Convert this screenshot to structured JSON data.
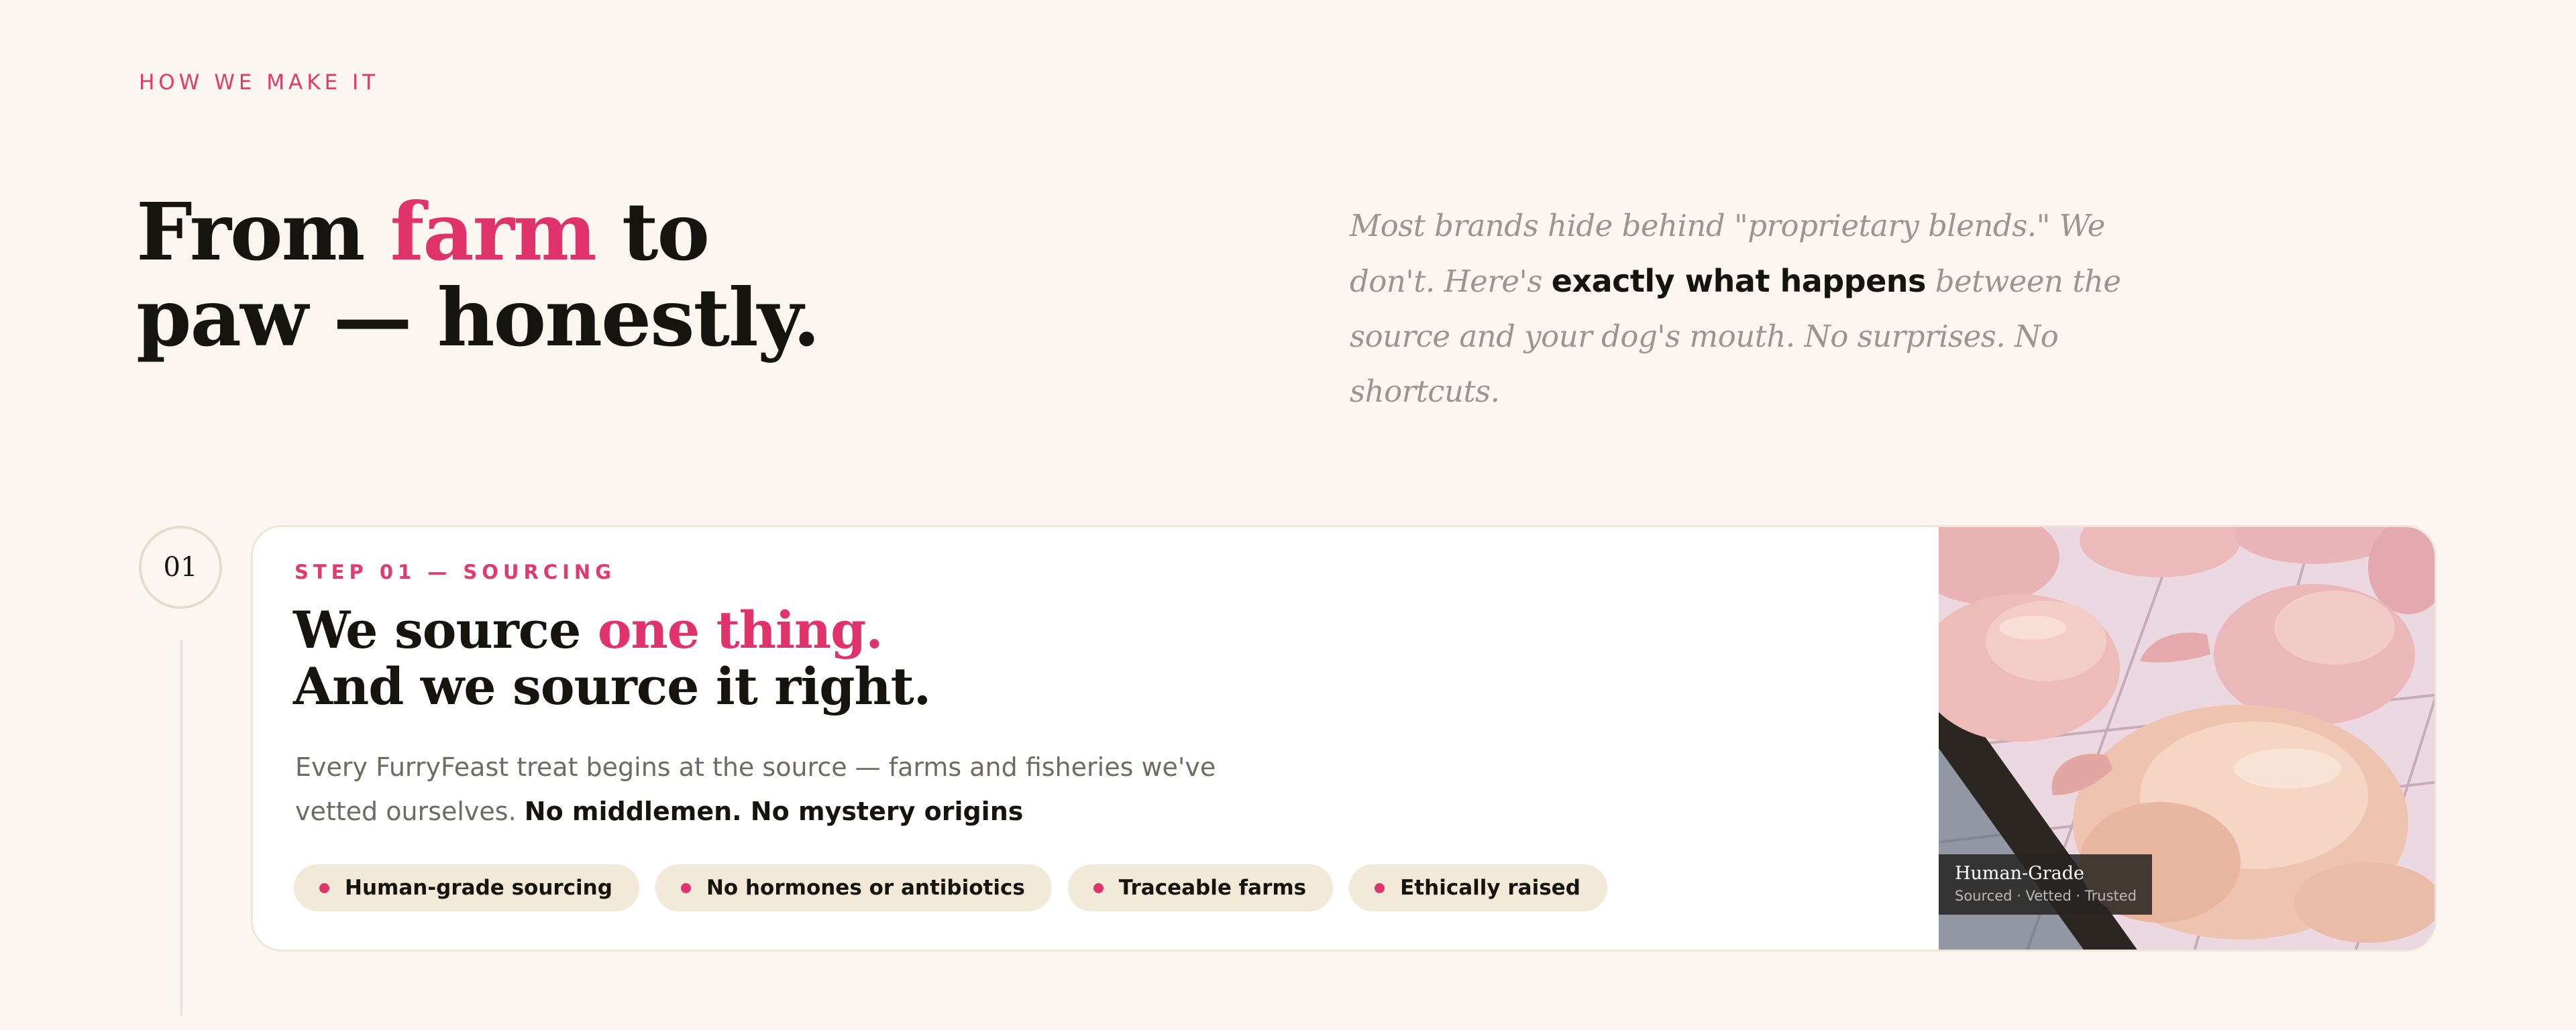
{
  "section": {
    "eyebrow": "HOW WE MAKE IT",
    "title": {
      "line1_before": "From ",
      "line1_accent": "farm",
      "line1_after": " to",
      "line2": "paw — honestly."
    },
    "intro": {
      "part1": "Most brands hide behind \"proprietary blends.\" We don't. Here's ",
      "strong": "exactly what happens",
      "part2": " between the source and your dog's mouth. No surprises. No shortcuts."
    }
  },
  "step": {
    "number": "01",
    "label": "STEP 01 — SOURCING",
    "title": {
      "line1_before": "We source ",
      "line1_accent": "one thing.",
      "line2": "And we source it right."
    },
    "body": {
      "text": "Every FurryFeast treat begins at the source — farms and fisheries we've vetted ourselves. ",
      "strong": "No middlemen. No mystery origins"
    },
    "tags": [
      "Human-grade sourcing",
      "No hormones or antibiotics",
      "Traceable farms",
      "Ethically raised"
    ],
    "image": {
      "caption_title": "Human-Grade",
      "caption_sub": "Sourced · Vetted · Trusted"
    }
  },
  "colors": {
    "background": "#FBF7F0",
    "accent": "#E0336C",
    "ink": "#16140F",
    "muted": "#9A9590",
    "tag_bg": "#F2E9D8"
  }
}
